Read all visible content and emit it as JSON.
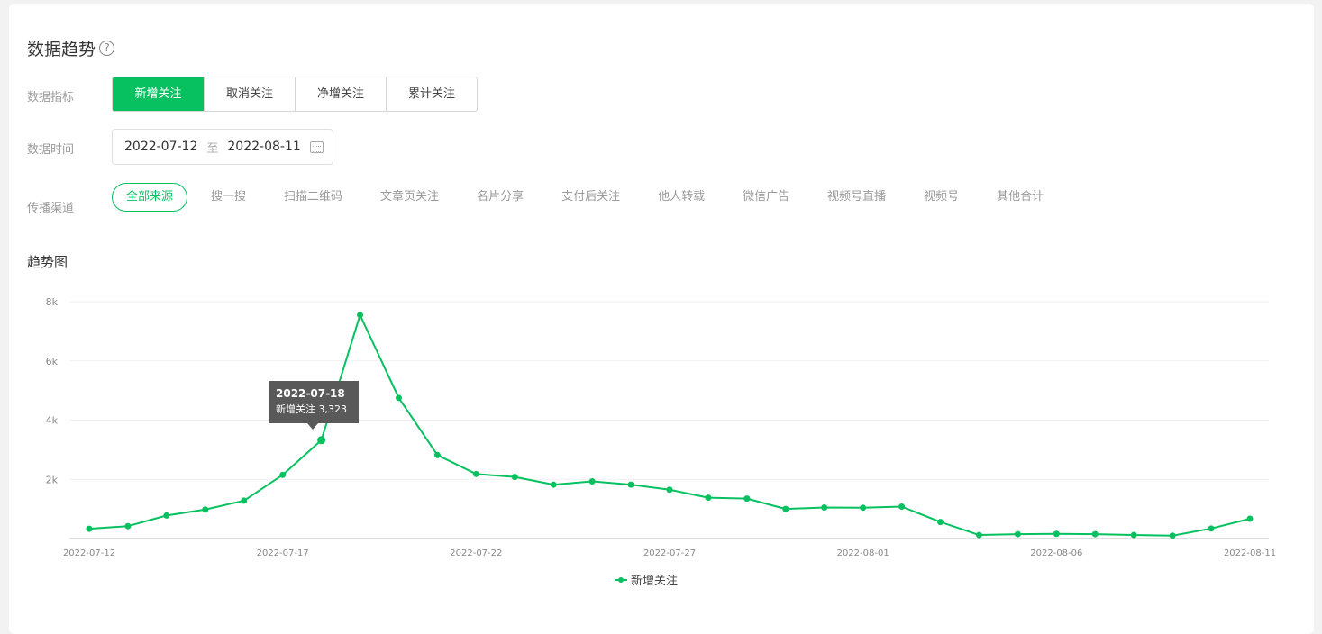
{
  "header": {
    "title": "数据趋势",
    "help_icon": "?"
  },
  "filters": {
    "metric_label": "数据指标",
    "metrics": [
      "新增关注",
      "取消关注",
      "净增关注",
      "累计关注"
    ],
    "time_label": "数据时间",
    "date_start": "2022-07-12",
    "date_sep": "至",
    "date_end": "2022-08-11",
    "channel_label": "传播渠道",
    "channels": [
      "全部来源",
      "搜一搜",
      "扫描二维码",
      "文章页关注",
      "名片分享",
      "支付后关注",
      "他人转载",
      "微信广告",
      "视频号直播",
      "视频号",
      "其他合计"
    ]
  },
  "trend_title": "趋势图",
  "tooltip": {
    "date": "2022-07-18",
    "series": "新增关注",
    "value": "3,323"
  },
  "colors": {
    "accent": "#07c160",
    "tooltip_bg": "#595959"
  },
  "chart_data": {
    "type": "line",
    "x": [
      "2022-07-12",
      "2022-07-13",
      "2022-07-14",
      "2022-07-15",
      "2022-07-16",
      "2022-07-17",
      "2022-07-18",
      "2022-07-19",
      "2022-07-20",
      "2022-07-21",
      "2022-07-22",
      "2022-07-23",
      "2022-07-24",
      "2022-07-25",
      "2022-07-26",
      "2022-07-27",
      "2022-07-28",
      "2022-07-29",
      "2022-07-30",
      "2022-07-31",
      "2022-08-01",
      "2022-08-02",
      "2022-08-03",
      "2022-08-04",
      "2022-08-05",
      "2022-08-06",
      "2022-08-07",
      "2022-08-08",
      "2022-08-09",
      "2022-08-10",
      "2022-08-11"
    ],
    "series": [
      {
        "name": "新增关注",
        "values": [
          330,
          420,
          780,
          980,
          1280,
          2150,
          3323,
          7550,
          4750,
          2820,
          2180,
          2080,
          1820,
          1930,
          1820,
          1650,
          1380,
          1350,
          1000,
          1050,
          1040,
          1080,
          560,
          120,
          150,
          160,
          150,
          120,
          100,
          340,
          670
        ]
      }
    ],
    "x_ticks": [
      "2022-07-12",
      "2022-07-17",
      "2022-07-22",
      "2022-07-27",
      "2022-08-01",
      "2022-08-06",
      "2022-08-11"
    ],
    "y_ticks": [
      "2k",
      "4k",
      "6k",
      "8k"
    ],
    "y_tick_values": [
      2000,
      4000,
      6000,
      8000
    ],
    "ylim": [
      0,
      8000
    ],
    "grid": true,
    "legend": "bottom-center"
  }
}
